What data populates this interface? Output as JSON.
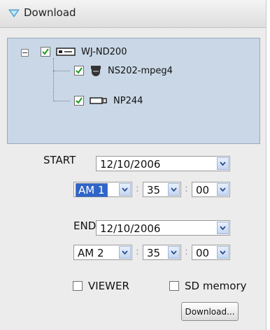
{
  "panel": {
    "title": "Download",
    "title_icon": "triangle-down-icon"
  },
  "tree": {
    "root": {
      "label": "WJ-ND200",
      "checked": true,
      "icon": "recorder-icon"
    },
    "children": [
      {
        "label": "NS202-mpeg4",
        "checked": true,
        "icon": "dome-camera-icon"
      },
      {
        "label": "NP244",
        "checked": true,
        "icon": "box-camera-icon"
      }
    ]
  },
  "start": {
    "label": "START",
    "date": "12/10/2006",
    "hour": "AM 1",
    "minute": "35",
    "second": "00"
  },
  "end": {
    "label": "END",
    "date": "12/10/2006",
    "hour": "AM 2",
    "minute": "35",
    "second": "00"
  },
  "separator": ":",
  "options": {
    "viewer_label": "VIEWER",
    "viewer_checked": false,
    "sd_label": "SD memory",
    "sd_checked": false
  },
  "download_button": "Download..."
}
